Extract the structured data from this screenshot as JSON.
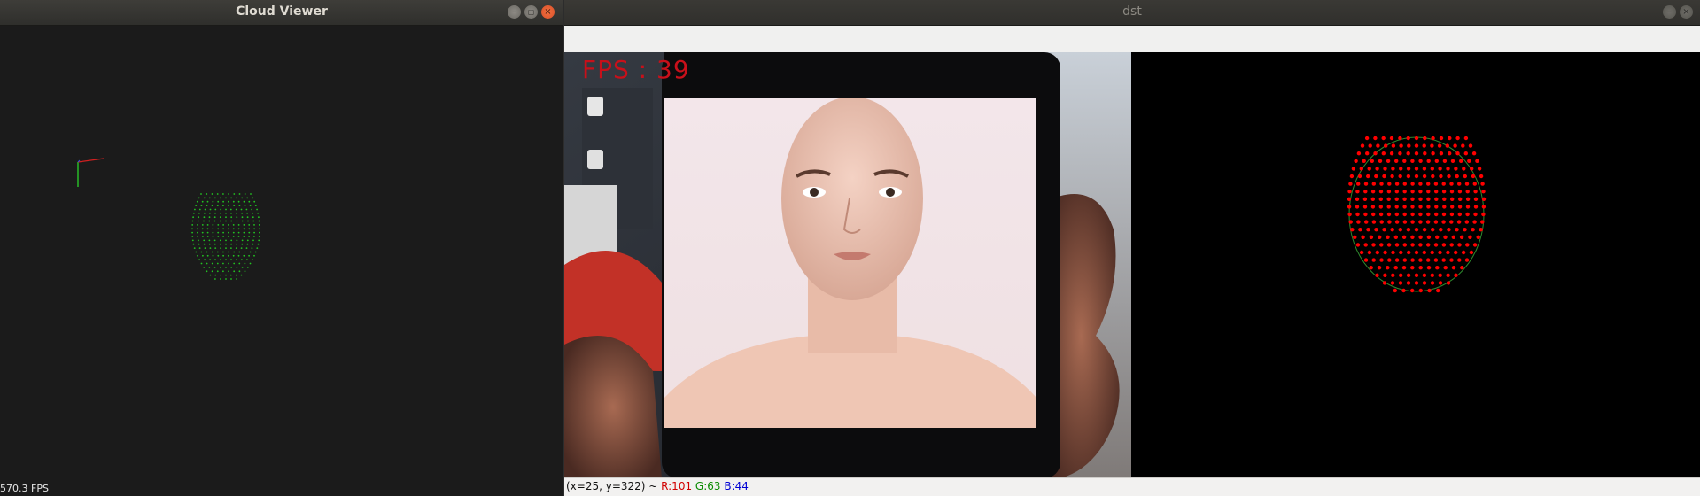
{
  "cloud_viewer": {
    "title": "Cloud Viewer",
    "fps_text": "570.3 FPS",
    "point_color": "#22c422",
    "background": "#1b1b1b"
  },
  "dst": {
    "title": "dst",
    "fps_overlay": "FPS : 39",
    "status": {
      "coords": "(x=25, y=322) ~ ",
      "r": "R:101",
      "g": "G:63",
      "b": "B:44"
    },
    "landmark_color": "#ff0000"
  },
  "window_buttons": {
    "minimize": "–",
    "maximize": "▢",
    "close": "×"
  },
  "icons": [
    "minimize-icon",
    "maximize-icon",
    "close-icon"
  ]
}
